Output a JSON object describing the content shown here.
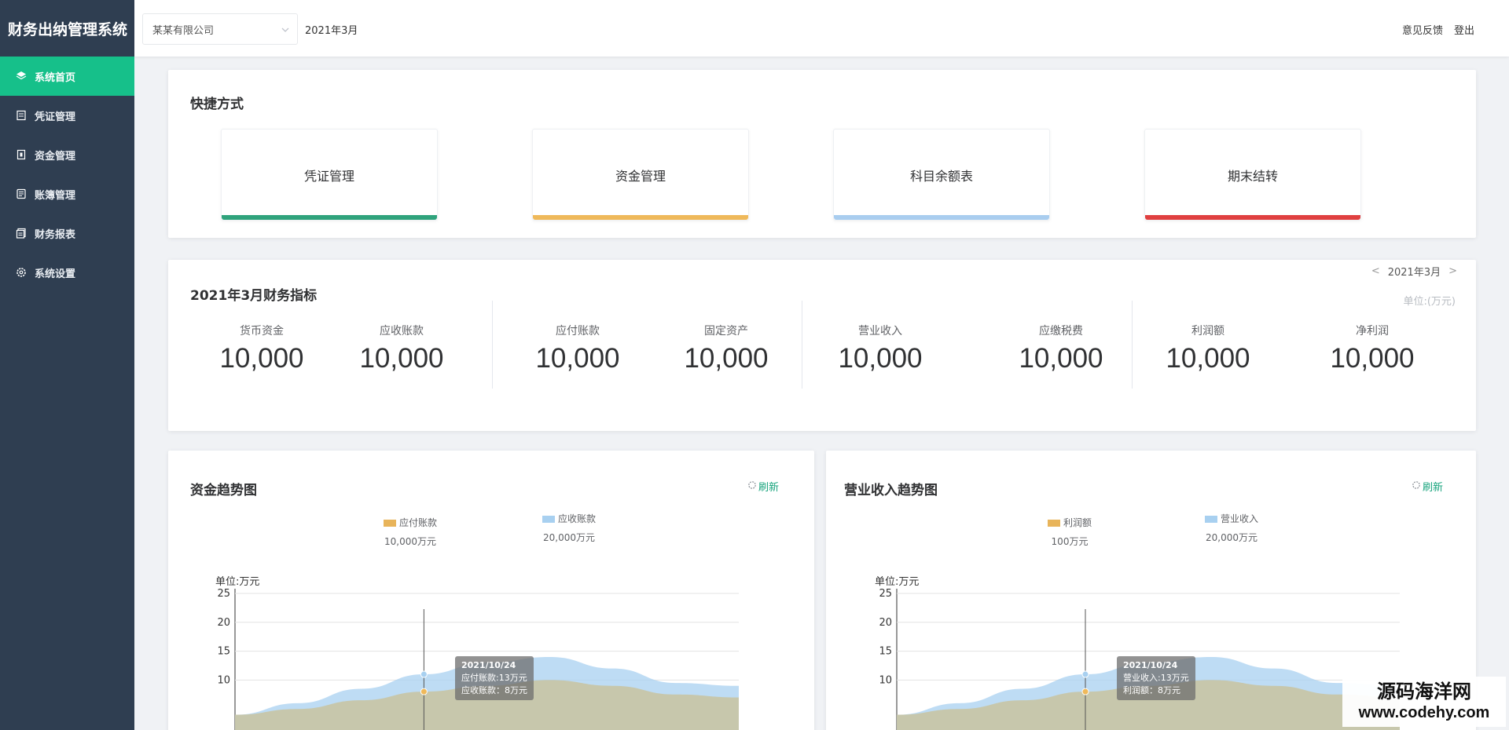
{
  "app": {
    "title": "财务出纳管理系统"
  },
  "sidebar": {
    "items": [
      {
        "label": "系统首页",
        "icon": "layers-icon",
        "active": true
      },
      {
        "label": "凭证管理",
        "icon": "voucher-icon",
        "active": false
      },
      {
        "label": "资金管理",
        "icon": "wallet-icon",
        "active": false
      },
      {
        "label": "账簿管理",
        "icon": "ledger-icon",
        "active": false
      },
      {
        "label": "财务报表",
        "icon": "report-icon",
        "active": false
      },
      {
        "label": "系统设置",
        "icon": "gear-icon",
        "active": false
      }
    ],
    "accent_color": "#16c08a",
    "bg_color": "#2f3e51"
  },
  "header": {
    "company_value": "某某有限公司",
    "period": "2021年3月",
    "feedback_label": "意见反馈",
    "logout_label": "登出"
  },
  "shortcuts": {
    "title": "快捷方式",
    "items": [
      {
        "label": "凭证管理",
        "color": "#2fa37c"
      },
      {
        "label": "资金管理",
        "color": "#efb95a"
      },
      {
        "label": "科目余额表",
        "color": "#a9cdef"
      },
      {
        "label": "期末结转",
        "color": "#e04040"
      }
    ]
  },
  "metrics": {
    "title": "2021年3月财务指标",
    "period": "2021年3月",
    "prev_label": "<",
    "next_label": ">",
    "unit": "单位:(万元)",
    "items": [
      {
        "label": "货币资金",
        "value": "10,000"
      },
      {
        "label": "应收账款",
        "value": "10,000"
      },
      {
        "label": "应付账款",
        "value": "10,000"
      },
      {
        "label": "固定资产",
        "value": "10,000"
      },
      {
        "label": "营业收入",
        "value": "10,000"
      },
      {
        "label": "应缴税费",
        "value": "10,000"
      },
      {
        "label": "利润额",
        "value": "10,000"
      },
      {
        "label": "净利润",
        "value": "10,000"
      }
    ]
  },
  "fund_chart": {
    "title": "资金趋势图",
    "refresh_label": "刷新",
    "unit_label": "单位:万元",
    "legend": [
      {
        "name": "应付账款",
        "value": "10,000万元",
        "color": "#e8b45a"
      },
      {
        "name": "应收账款",
        "value": "20,000万元",
        "color": "#a8d0f0"
      }
    ],
    "tooltip": {
      "date": "2021/10/24",
      "line1": "应付账款:13万元",
      "line2": "应收账款：8万元"
    }
  },
  "revenue_chart": {
    "title": "营业收入趋势图",
    "refresh_label": "刷新",
    "unit_label": "单位:万元",
    "legend": [
      {
        "name": "利润额",
        "value": "100万元",
        "color": "#e8b45a"
      },
      {
        "name": "营业收入",
        "value": "20,000万元",
        "color": "#a8d0f0"
      }
    ],
    "tooltip": {
      "date": "2021/10/24",
      "line1": "营业收入:13万元",
      "line2": "利润额：8万元"
    }
  },
  "chart_data": [
    {
      "type": "area",
      "title": "资金趋势图",
      "ylabel": "单位:万元",
      "ylim": [
        0,
        25
      ],
      "yticks": [
        25,
        20,
        15,
        10
      ],
      "x": [
        0,
        1,
        2,
        3,
        4,
        5,
        6,
        7,
        8
      ],
      "series": [
        {
          "name": "应收账款",
          "color": "#a8d0f0",
          "values": [
            4,
            6,
            8.5,
            11,
            13,
            14,
            12,
            9.5,
            9
          ]
        },
        {
          "name": "应付账款",
          "color": "#c8c4a4",
          "values": [
            4,
            5,
            6.5,
            8,
            9,
            10,
            9,
            7.5,
            7
          ]
        }
      ],
      "highlight_index": 3,
      "legend_position": "top"
    },
    {
      "type": "area",
      "title": "营业收入趋势图",
      "ylabel": "单位:万元",
      "ylim": [
        0,
        25
      ],
      "yticks": [
        25,
        20,
        15,
        10
      ],
      "x": [
        0,
        1,
        2,
        3,
        4,
        5,
        6,
        7,
        8
      ],
      "series": [
        {
          "name": "营业收入",
          "color": "#a8d0f0",
          "values": [
            4,
            6,
            8.5,
            11,
            13,
            14,
            12,
            9.5,
            9
          ]
        },
        {
          "name": "利润额",
          "color": "#c8c4a4",
          "values": [
            4,
            5,
            6.5,
            8,
            9,
            10,
            9,
            7.5,
            7
          ]
        }
      ],
      "highlight_index": 3,
      "legend_position": "top"
    }
  ],
  "watermark": {
    "line1": "源码海洋网",
    "line2": "www.codehy.com"
  }
}
